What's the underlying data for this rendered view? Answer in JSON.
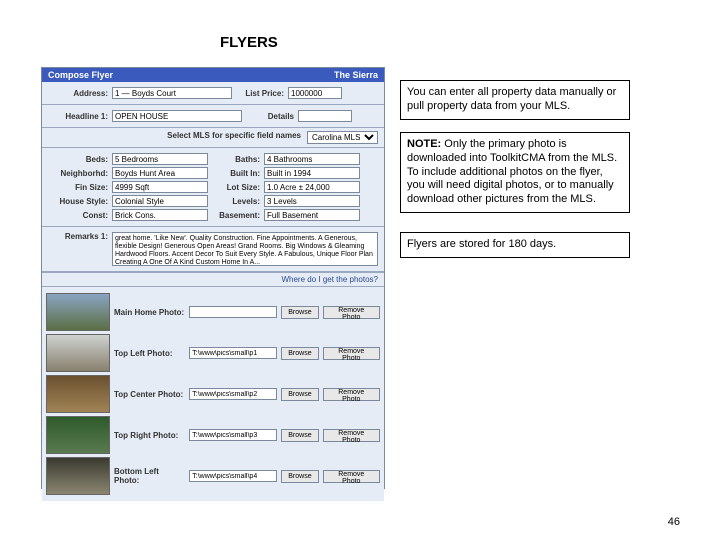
{
  "heading": "FLYERS",
  "app": {
    "title_left": "Compose Flyer",
    "title_right": "The Sierra",
    "top_row": {
      "address_label": "Address:",
      "address_value": "1 — Boyds Court",
      "listprice_label": "List Price:",
      "listprice_value": "1000000"
    },
    "headline": {
      "label": "Headline 1:",
      "value": "OPEN HOUSE",
      "details_label": "Details"
    },
    "mls_prompt_label": "Select MLS for specific field names",
    "mls_prompt_value": "Carolina MLS",
    "fields": [
      {
        "l": "Beds:",
        "v": "5 Bedrooms",
        "r": "Baths:",
        "rv": "4 Bathrooms"
      },
      {
        "l": "Neighborhd:",
        "v": "Boyds Hunt Area",
        "r": "Built In:",
        "rv": "Built in 1994"
      },
      {
        "l": "Fin Size:",
        "v": "4999 Sqft",
        "r": "Lot Size:",
        "rv": "1.0 Acre ± 24,000"
      },
      {
        "l": "House Style:",
        "v": "Colonial Style",
        "r": "Levels:",
        "rv": "3 Levels"
      },
      {
        "l": "Const:",
        "v": "Brick Cons.",
        "r": "Basement:",
        "rv": "Full Basement"
      }
    ],
    "remarks": {
      "label": "Remarks 1:",
      "text": "great home. 'Like New'. Quality Construction. Fine Appointments. A Generous, flexible Design! Generous Open Areas! Grand Rooms. Big Windows & Gleaming Hardwood Floors. Accent Decor To Suit Every Style. A Fabulous, Unique Floor Plan Creating A One Of A Kind Custom Home In A..."
    },
    "photo_prompt": "Where do I get the photos?",
    "photos": [
      {
        "label": "Main Home Photo:",
        "path": "",
        "browse": "Browse",
        "remove": "Remove Photo",
        "grad": "linear-gradient(#8aa4c2,#5b6f44)"
      },
      {
        "label": "Top Left Photo:",
        "path": "T:\\www\\pics\\small\\p1",
        "browse": "Browse",
        "remove": "Remove Photo",
        "grad": "linear-gradient(#cfd2d0,#88806e)"
      },
      {
        "label": "Top Center Photo:",
        "path": "T:\\www\\pics\\small\\p2",
        "browse": "Browse",
        "remove": "Remove Photo",
        "grad": "linear-gradient(#6b5030,#a08455)"
      },
      {
        "label": "Top Right Photo:",
        "path": "T:\\www\\pics\\small\\p3",
        "browse": "Browse",
        "remove": "Remove Photo",
        "grad": "linear-gradient(#2e5a2b,#5a7a4f)"
      },
      {
        "label": "Bottom Left Photo:",
        "path": "T:\\www\\pics\\small\\p4",
        "browse": "Browse",
        "remove": "Remove Photo",
        "grad": "linear-gradient(#3a3a30,#8a8670)"
      }
    ]
  },
  "textboxes": {
    "t1": "You can enter all property data manually or pull property data from your MLS.",
    "t2_note": "NOTE:",
    "t2_body": "  Only the primary photo is downloaded into ToolkitCMA from the MLS.  To include additional photos on the flyer, you will need digital photos, or to manually download other pictures from the MLS.",
    "t3": "Flyers are stored for 180 days."
  },
  "page_number": "46"
}
